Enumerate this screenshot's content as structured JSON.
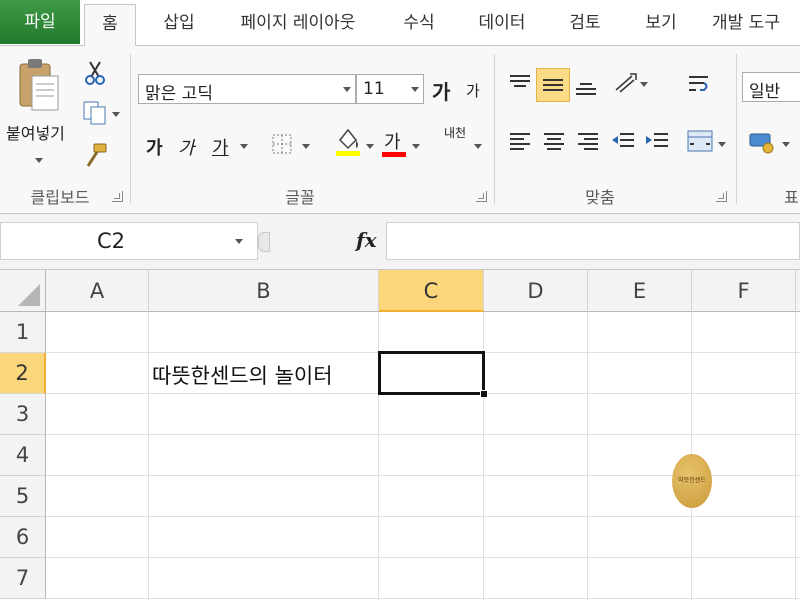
{
  "tabs": [
    {
      "label": "파일"
    },
    {
      "label": "홈"
    },
    {
      "label": "삽입"
    },
    {
      "label": "페이지 레이아웃"
    },
    {
      "label": "수식"
    },
    {
      "label": "데이터"
    },
    {
      "label": "검토"
    },
    {
      "label": "보기"
    },
    {
      "label": "개발 도구"
    }
  ],
  "ribbon": {
    "clipboard": {
      "paste_label": "붙여넣기",
      "group_label": "클립보드"
    },
    "font": {
      "font_name": "맑은 고딕",
      "font_size": "11",
      "grow_label": "가",
      "shrink_label": "가",
      "bold_label": "가",
      "italic_label": "가",
      "underline_label": "가",
      "font_color_label": "가",
      "phonetic_label": "내천",
      "group_label": "글꼴",
      "fill_color": "#ffff00",
      "font_color": "#ff0000"
    },
    "alignment": {
      "group_label": "맞춤"
    },
    "number": {
      "format": "일반",
      "group_label": "표"
    }
  },
  "formula_bar": {
    "name_box": "C2",
    "fx_label": "fx",
    "content": ""
  },
  "grid": {
    "columns": [
      "A",
      "B",
      "C",
      "D",
      "E",
      "F"
    ],
    "rows": [
      "1",
      "2",
      "3",
      "4",
      "5",
      "6",
      "7"
    ],
    "selected_column": "C",
    "selected_row": "2",
    "cells": {
      "B2": "따뜻한센드의 놀이터"
    },
    "watermark_text": "따뜻한센드"
  },
  "colors": {
    "file_tab": "#217a2c",
    "selection_header": "#fbd67a",
    "selection_accent": "#f0b036"
  }
}
